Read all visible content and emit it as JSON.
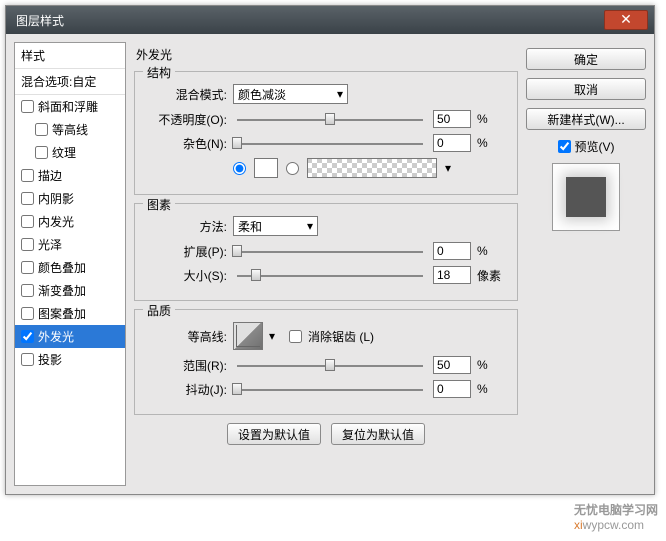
{
  "window": {
    "title": "图层样式"
  },
  "sidebar": {
    "styles_label": "样式",
    "blend_options_label": "混合选项:自定",
    "items": [
      {
        "label": "斜面和浮雕",
        "checked": false
      },
      {
        "label": "等高线",
        "checked": false,
        "indent": true
      },
      {
        "label": "纹理",
        "checked": false,
        "indent": true
      },
      {
        "label": "描边",
        "checked": false
      },
      {
        "label": "内阴影",
        "checked": false
      },
      {
        "label": "内发光",
        "checked": false
      },
      {
        "label": "光泽",
        "checked": false
      },
      {
        "label": "颜色叠加",
        "checked": false
      },
      {
        "label": "渐变叠加",
        "checked": false
      },
      {
        "label": "图案叠加",
        "checked": false
      },
      {
        "label": "外发光",
        "checked": true,
        "selected": true
      },
      {
        "label": "投影",
        "checked": false
      }
    ]
  },
  "main": {
    "section_title": "外发光",
    "structure": {
      "legend": "结构",
      "blend_mode_label": "混合模式:",
      "blend_mode_value": "颜色减淡",
      "opacity_label": "不透明度(O):",
      "opacity_value": "50",
      "opacity_unit": "%",
      "noise_label": "杂色(N):",
      "noise_value": "0",
      "noise_unit": "%"
    },
    "elements": {
      "legend": "图素",
      "technique_label": "方法:",
      "technique_value": "柔和",
      "spread_label": "扩展(P):",
      "spread_value": "0",
      "spread_unit": "%",
      "size_label": "大小(S):",
      "size_value": "18",
      "size_unit": "像素"
    },
    "quality": {
      "legend": "品质",
      "contour_label": "等高线:",
      "antialias_label": "消除锯齿 (L)",
      "range_label": "范围(R):",
      "range_value": "50",
      "range_unit": "%",
      "jitter_label": "抖动(J):",
      "jitter_value": "0",
      "jitter_unit": "%"
    },
    "defaults": {
      "set_default": "设置为默认值",
      "reset_default": "复位为默认值"
    }
  },
  "right": {
    "ok": "确定",
    "cancel": "取消",
    "new_style": "新建样式(W)...",
    "preview": "预览(V)"
  },
  "watermark": {
    "brand": "无忧电脑学习网",
    "url": "wypcw.com",
    "prefix": "xi"
  }
}
